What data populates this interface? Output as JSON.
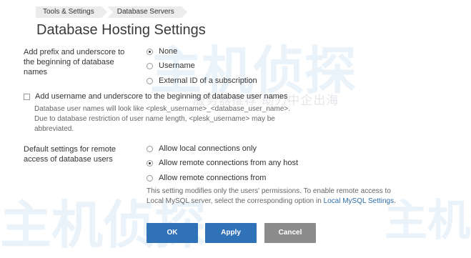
{
  "breadcrumb": [
    "Tools & Settings",
    "Database Servers"
  ],
  "page_title": "Database Hosting Settings",
  "prefix_section": {
    "label": "Add prefix and underscore to the beginning of database names",
    "label_lines": [
      "Add prefix and underscore to",
      "the beginning of database",
      "names"
    ],
    "options": [
      {
        "label": "None",
        "checked": true
      },
      {
        "label": "Username",
        "checked": false
      },
      {
        "label": "External ID of a subscription",
        "checked": false
      }
    ]
  },
  "username_checkbox": {
    "label": "Add username and underscore to the beginning of database user names",
    "checked": false,
    "hint_lines": [
      "Database user names will look like <plesk_username>_<database_user_name>.",
      "Due to database restriction of user name length, <plesk_username> may be",
      "abbreviated."
    ]
  },
  "remote_section": {
    "label": "Default settings for remote access of database users",
    "label_lines": [
      "Default settings for remote",
      "access of database users"
    ],
    "options": [
      {
        "label": "Allow local connections only",
        "checked": false
      },
      {
        "label": "Allow remote connections from any host",
        "checked": true
      },
      {
        "label": "Allow remote connections from",
        "checked": false
      }
    ],
    "hint_line1": "This setting modifies only the users' permissions. To enable remote access to",
    "hint_line2_prefix": "Local MySQL server, select the corresponding option in ",
    "hint_link": "Local MySQL Settings",
    "hint_line2_suffix": "."
  },
  "buttons": {
    "ok": "OK",
    "apply": "Apply",
    "cancel": "Cancel"
  },
  "colors": {
    "primary_button": "#2f72b8",
    "cancel_button": "#8c8c8c",
    "link": "#2f6ea8"
  },
  "watermark": {
    "large": "主机侦探",
    "small": "服务器推荐 助力中企出海"
  }
}
